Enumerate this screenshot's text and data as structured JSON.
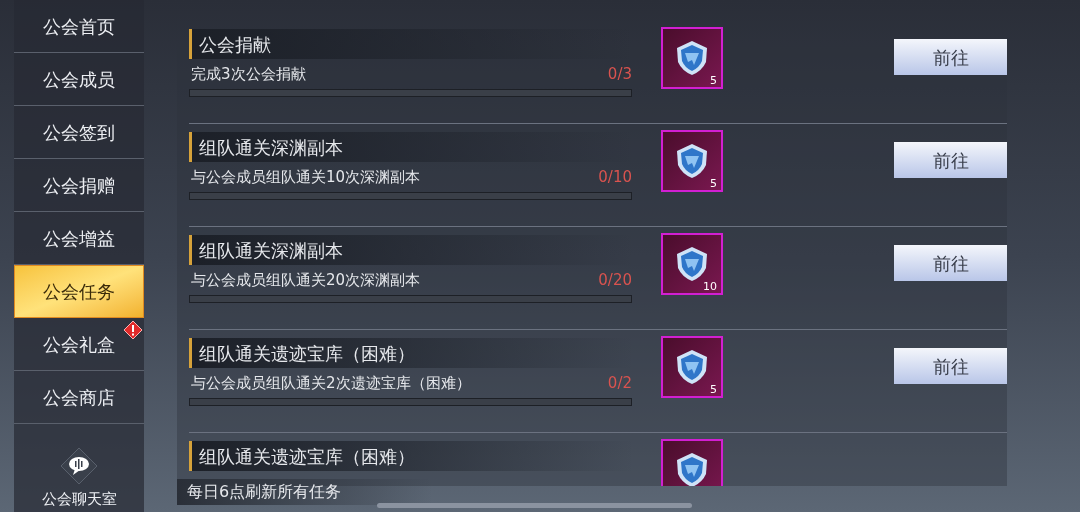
{
  "sidebar": {
    "items": [
      {
        "label": "公会首页",
        "selected": false,
        "alert": false
      },
      {
        "label": "公会成员",
        "selected": false,
        "alert": false
      },
      {
        "label": "公会签到",
        "selected": false,
        "alert": false
      },
      {
        "label": "公会捐赠",
        "selected": false,
        "alert": false
      },
      {
        "label": "公会增益",
        "selected": false,
        "alert": false
      },
      {
        "label": "公会任务",
        "selected": true,
        "alert": false
      },
      {
        "label": "公会礼盒",
        "selected": false,
        "alert": true
      },
      {
        "label": "公会商店",
        "selected": false,
        "alert": false
      }
    ],
    "chat_button": {
      "label": "公会聊天室"
    }
  },
  "tasks": [
    {
      "title": "公会捐献",
      "description": "完成3次公会捐献",
      "progress": "0/3",
      "level": 0,
      "reward_count": "5",
      "button": "前往"
    },
    {
      "title": "组队通关深渊副本",
      "description": "与公会成员组队通关10次深渊副本",
      "progress": "0/10",
      "level": 0,
      "reward_count": "5",
      "button": "前往"
    },
    {
      "title": "组队通关深渊副本",
      "description": "与公会成员组队通关20次深渊副本",
      "progress": "0/20",
      "level": 0,
      "reward_count": "10",
      "button": "前往"
    },
    {
      "title": "组队通关遗迹宝库（困难）",
      "description": "与公会成员组队通关2次遗迹宝库（困难）",
      "progress": "0/2",
      "level": 0,
      "reward_count": "5",
      "button": "前往"
    },
    {
      "title": "组队通关遗迹宝库（困难）"
    }
  ],
  "footer": {
    "notice": "每日6点刷新所有任务"
  }
}
